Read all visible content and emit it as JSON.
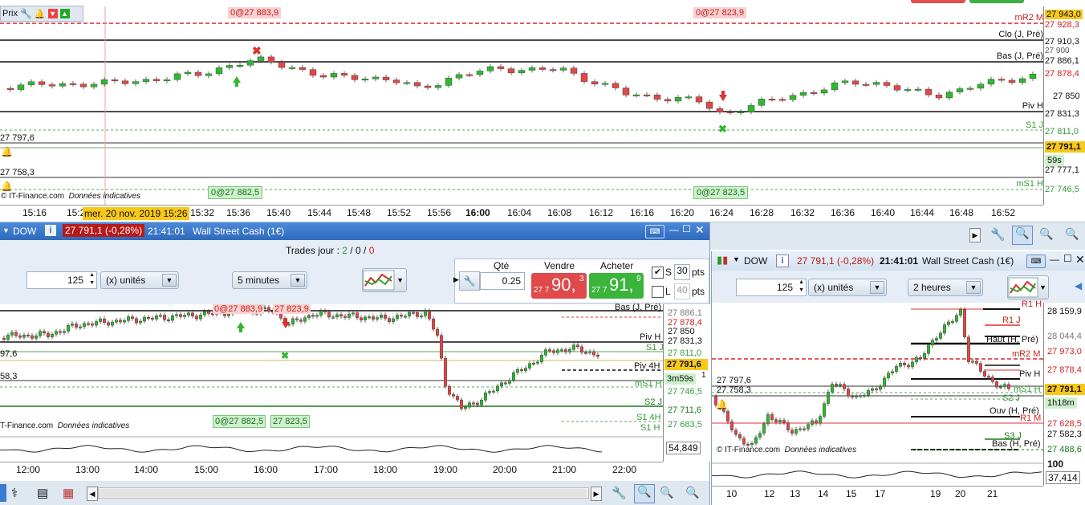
{
  "top_chart": {
    "panel_title": "Prix",
    "order_labels": {
      "sell_left": "0@27 883,9",
      "sell_right": "0@27 823,9",
      "buy_left": "0@27 882,5",
      "buy_right": "0@27 823,5"
    },
    "level_labels": {
      "mr2": "mR2 M",
      "clo": "Clo (J, Pré)",
      "bas": "Bas (J, Pré)",
      "piv": "Piv H",
      "s1": "S1 J",
      "ms1": "mS1 H"
    },
    "axis_prices": [
      "27 943,0",
      "27 928,3",
      "27 910,3",
      "27 900",
      "27 886,1",
      "27 878,4",
      "27 850",
      "27 831,3",
      "27 811,0",
      "27 791,1",
      "27 777,1",
      "27 746,5"
    ],
    "current_price": "27 791,1",
    "countdown": "59s",
    "left_labels": {
      "a": "27 797,6",
      "b": "27 758,3"
    },
    "copyright": "© IT-Finance.com",
    "disclaimer": "Données indicatives",
    "tooltip_date": "mer. 20 nov. 2019 15:26",
    "time_labels": [
      "15:16",
      "15:2",
      "15:32",
      "15:36",
      "15:40",
      "15:44",
      "15:48",
      "15:52",
      "15:56",
      "16:00",
      "16:04",
      "16:08",
      "16:12",
      "16:16",
      "16:20",
      "16:24",
      "16:28",
      "16:32",
      "16:36",
      "16:40",
      "16:44",
      "16:48",
      "16:52"
    ]
  },
  "dow_left": {
    "symbol": "DOW",
    "price_badge": "27 791,1 (-0,28%)",
    "time": "21:41:01",
    "name": "Wall Street Cash (1€)",
    "trades_label": "Trades jour :",
    "trades_green": "2",
    "trades_sep1": "/",
    "trades_dark": "0",
    "trades_sep2": "/",
    "trades_red": "0",
    "quantity": "125",
    "unit": "(x) unités",
    "timeframe": "5 minutes",
    "qty_label": "Qté",
    "qty_value": "0.25",
    "sell_label": "Vendre",
    "buy_label": "Acheter",
    "sell_price_small": "27 7",
    "sell_price_big": "90,",
    "sell_price_sup": "3",
    "buy_price_small": "27 7",
    "buy_price_big": "91,",
    "buy_price_sup": "9",
    "s_label": "S",
    "s_value": "30",
    "l_label": "L",
    "l_value": "40",
    "pts": "pts",
    "chart": {
      "order_labels": {
        "s1": "0@27 883,9",
        "s2": "27 823,9",
        "b1": "0@27 882,5",
        "b2": "27 823,5"
      },
      "level_labels": {
        "bas": "Bas (J, Pré)",
        "piv": "Piv H",
        "s1": "S1 J",
        "piv4": "Piv 4H",
        "ms1": "mS1 H",
        "s2": "S2 J",
        "s14": "S1 4H",
        "s1h": "S1 H"
      },
      "axis_prices": [
        "27 886,1",
        "27 878,4",
        "27 850",
        "27 831,3",
        "27 811,0",
        "27 746,5",
        "27 711,6",
        "27 683,5"
      ],
      "current_price": "27 791,6",
      "countdown": "3m59s",
      "countdown_suffix": "1",
      "left_a": "97,6",
      "left_b": "58,3",
      "copyright": "T-Finance.com",
      "disclaimer": "Données indicatives",
      "osc_value": "54,849",
      "time_labels": [
        "12:00",
        "13:00",
        "14:00",
        "15:00",
        "16:00",
        "17:00",
        "18:00",
        "19:00",
        "20:00",
        "21:00",
        "22:00"
      ]
    }
  },
  "dow_right": {
    "symbol": "DOW",
    "price_badge": "27 791,1 (-0,28%)",
    "time": "21:41:01",
    "name": "Wall Street Cash (1€)",
    "quantity": "125",
    "unit": "(x) unités",
    "timeframe": "2 heures",
    "chart": {
      "level_labels": {
        "r1h": "R1 H",
        "r1j": "R1 J",
        "haut": "Haut (H, Pré)",
        "mr2": "mR2 M",
        "piv": "Piv H",
        "ms1": "mS1 H",
        "s2": "S2 J",
        "ouv": "Ouv (H, Pré)",
        "r1m": "R1 M",
        "s3": "S3 J",
        "bas": "Bas (H, Pré)"
      },
      "axis_prices": [
        "28 159,9",
        "28 044,4",
        "27 973,0",
        "27 878,4",
        "27 791,1",
        "27 628,5",
        "27 582,3",
        "27 488,6"
      ],
      "current_price": "27 791,1",
      "countdown": "1h18m",
      "left_a": "27 797,6",
      "left_b": "27 758,3",
      "copyright": "© IT-Finance.com",
      "disclaimer": "Données indicatives",
      "osc_top": "100",
      "osc_value": "37,414",
      "time_labels": [
        "10",
        "12",
        "13",
        "14",
        "15",
        "17",
        "19",
        "20",
        "21"
      ]
    }
  },
  "colors": {
    "up": "#2fb82f",
    "down": "#e04848",
    "price_tag": "#f7c81a",
    "header_blue": "#3b7bd0",
    "badge_red": "#b81a1a"
  }
}
